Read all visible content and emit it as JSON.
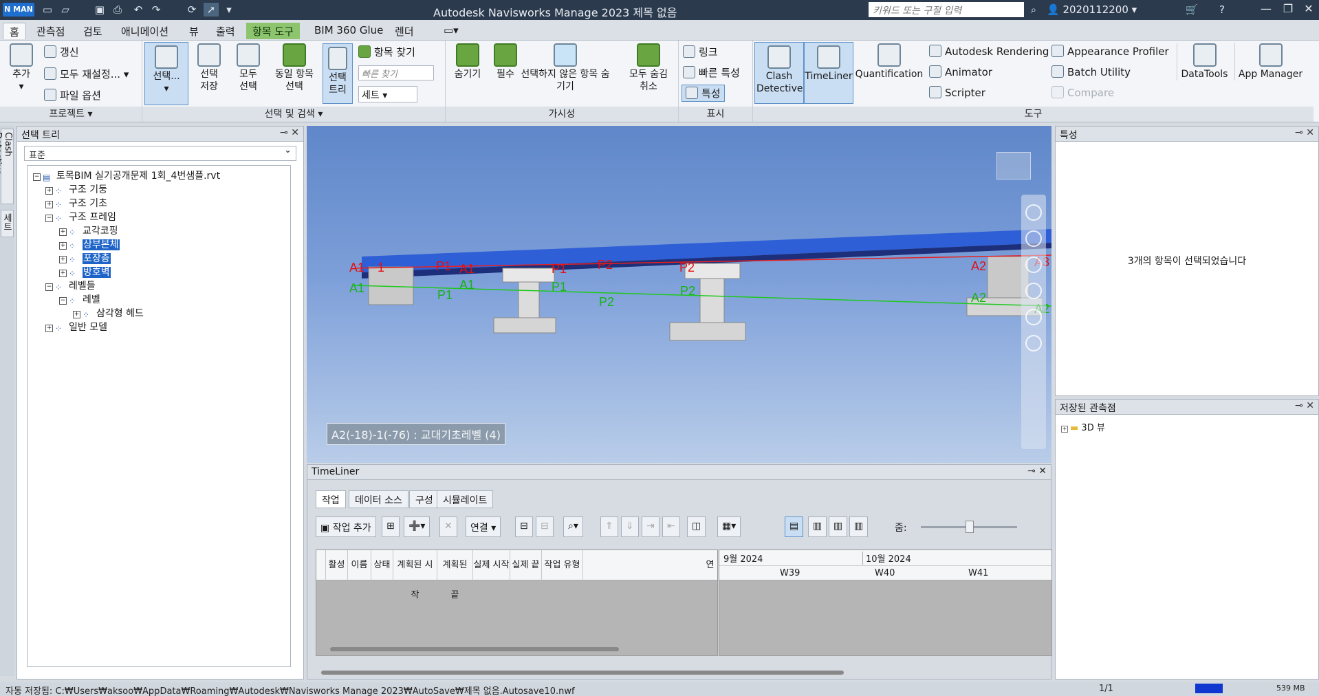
{
  "titlebar": {
    "logo": "N MAN",
    "title": "Autodesk Navisworks Manage 2023     제목 없음",
    "search_placeholder": "키워드 또는 구절 입력",
    "user": "2020112200"
  },
  "tabs": [
    "홈",
    "관측점",
    "검토",
    "애니메이션",
    "뷰",
    "출력",
    "항목 도구",
    "BIM 360 Glue",
    "렌더"
  ],
  "ribbon": {
    "project": {
      "add": "추가",
      "refresh": "갱신",
      "reset_all": "모두 재설정...",
      "file_options": "파일 옵션",
      "label": "프로젝트 ▾"
    },
    "select": {
      "select": "선택...",
      "save_sel": "선택 저장",
      "select_all": "모두 선택",
      "same_select": "동일 항목 선택",
      "sel_tree": "선택 트리",
      "find_items": "항목 찾기",
      "quick_find": "빠른 찾기",
      "sets": "세트",
      "label": "선택 및 검색 ▾"
    },
    "visibility": {
      "hide": "숨기기",
      "required": "필수",
      "hide_unselected": "선택하지 않은 항목 숨기기",
      "unhide_all": "모두 숨김 취소",
      "label": "가시성"
    },
    "display": {
      "links": "링크",
      "quick_props": "빠른 특성",
      "properties": "특성",
      "label": "표시"
    },
    "tools": {
      "clash": "Clash Detective",
      "timeliner": "TimeLiner",
      "quant": "Quantification",
      "rendering": "Autodesk Rendering",
      "animator": "Animator",
      "scripter": "Scripter",
      "appearance": "Appearance Profiler",
      "batch": "Batch Utility",
      "compare": "Compare",
      "datatools": "DataTools",
      "appmanager": "App Manager",
      "label": "도구"
    }
  },
  "left_strip": {
    "clash": "Clash Detective",
    "sets": "세트"
  },
  "sel_tree": {
    "title": "선택 트리",
    "mode": "표준",
    "nodes": [
      {
        "label": "토목BIM 실기공개문제 1회_4번샘플.rvt",
        "toggle": "−",
        "hl": false
      },
      {
        "label": "구조 기둥",
        "toggle": "+",
        "hl": false
      },
      {
        "label": "구조 기초",
        "toggle": "+",
        "hl": false
      },
      {
        "label": "구조 프레임",
        "toggle": "−",
        "hl": false
      },
      {
        "label": "교각코핑",
        "toggle": "+",
        "hl": false
      },
      {
        "label": "상부본체",
        "toggle": "+",
        "hl": true
      },
      {
        "label": "포장층",
        "toggle": "+",
        "hl": true
      },
      {
        "label": "방호벽",
        "toggle": "+",
        "hl": true
      },
      {
        "label": "레벨들",
        "toggle": "−",
        "hl": false
      },
      {
        "label": "레벨",
        "toggle": "−",
        "hl": false
      },
      {
        "label": "삼각형 헤드",
        "toggle": "+",
        "hl": false
      },
      {
        "label": "일반 모델",
        "toggle": "+",
        "hl": false
      }
    ]
  },
  "viewport": {
    "label": "A2(-18)-1(-76) : 교대기초레벨 (4)",
    "grid_red": [
      "A1",
      "1",
      "P1",
      "A1",
      "P1",
      "P2",
      "P2",
      "A2",
      "A3"
    ],
    "grid_green": [
      "A1",
      "P1",
      "A1",
      "P1",
      "P2",
      "P2",
      "A2",
      "A2"
    ]
  },
  "timeliner": {
    "title": "TimeLiner",
    "tabs": [
      "작업",
      "데이터 소스",
      "구성",
      "시뮬레이트"
    ],
    "add_task": "작업 추가",
    "link": "연결",
    "zoom": "줌:",
    "columns": [
      "활성",
      "이름",
      "상태",
      "계획된 시작",
      "계획된 끝",
      "실제 시작",
      "실제 끝",
      "작업 유형",
      "연"
    ],
    "months": [
      "9월 2024",
      "10월 2024"
    ],
    "weeks": [
      "W39",
      "W40",
      "W41"
    ]
  },
  "properties": {
    "title": "특성",
    "message": "3개의 항목이 선택되었습니다"
  },
  "viewpoints": {
    "title": "저장된 관측점",
    "item": "3D 뷰"
  },
  "status": {
    "text": "자동 저장됨: C:₩Users₩aksoo₩AppData₩Roaming₩Autodesk₩Navisworks Manage 2023₩AutoSave₩제목 없음.Autosave10.nwf",
    "page": "1/1",
    "mem": "539 MB"
  }
}
